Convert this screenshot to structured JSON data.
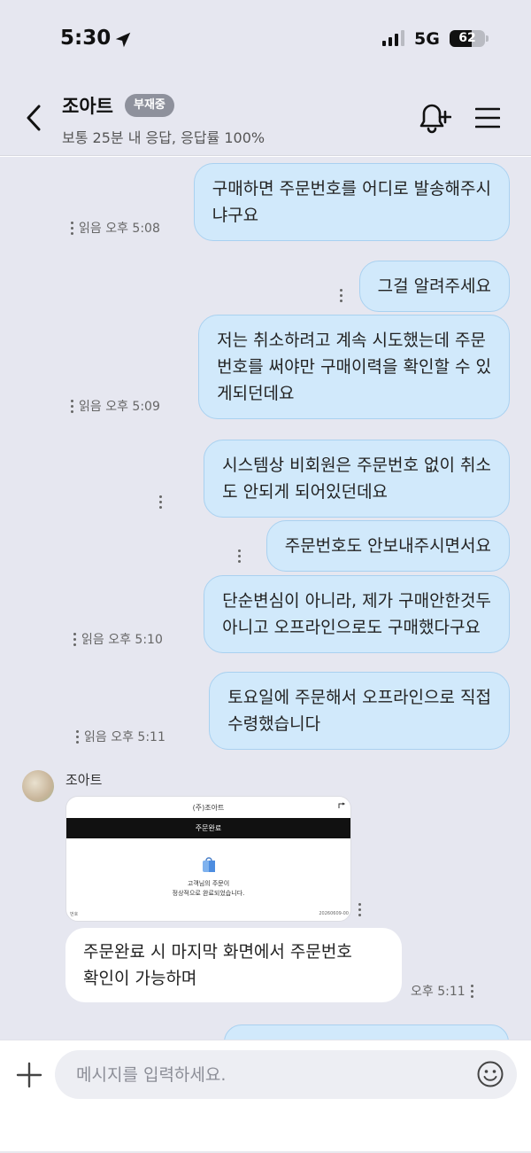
{
  "status_bar": {
    "time": "5:30",
    "network": "5G",
    "battery_percent": "62",
    "battery_level": 0.62,
    "location_icon": "location-arrow-icon",
    "signal_icon": "signal-bars-icon"
  },
  "header": {
    "back_icon": "chevron-left-icon",
    "name": "조아트",
    "badge": "부재중",
    "subtitle": "보통 25분 내 응답, 응답률 100%",
    "notify_icon": "bell-plus-icon",
    "menu_icon": "hamburger-menu-icon"
  },
  "messages": [
    {
      "direction": "out",
      "text": "구매하면 주문번호를 어디로 발송해주시\n냐구요",
      "meta": "읽음 오후 5:08"
    },
    {
      "direction": "out",
      "text": "그걸 알려주세요",
      "meta": ""
    },
    {
      "direction": "out",
      "text": "저는 취소하려고 계속 시도했는데 주문\n번호를 써야만 구매이력을 확인할 수 있\n게되던데요",
      "meta": "읽음 오후 5:09"
    },
    {
      "direction": "out",
      "text": "시스템상 비회원은 주문번호 없이 취소\n도 안되게 되어있던데요",
      "meta": ""
    },
    {
      "direction": "out",
      "text": "주문번호도 안보내주시면서요",
      "meta": ""
    },
    {
      "direction": "out",
      "text": "단순변심이 아니라, 제가 구매안한것두\n아니고 오프라인으로도 구매했다구요",
      "meta": "읽음 오후 5:10"
    },
    {
      "direction": "out",
      "text": "토요일에 주문해서 오프라인으로 직접\n수령했습니다",
      "meta": "읽음 오후 5:11"
    },
    {
      "direction": "in",
      "text": "주문완료 시 마지막 화면에서 주문번호\n확인이 가능하며",
      "meta": "오후 5:11"
    }
  ],
  "incoming": {
    "sender": "조아트",
    "avatar_icon": "store-avatar",
    "image_card": {
      "title": "(주)조아트",
      "bar": "주문완료",
      "line1": "고객님의 주문이",
      "line2": "정상적으로 완료되었습니다.",
      "left_text": "번호",
      "right_text": "20260609-00"
    }
  },
  "input": {
    "placeholder": "메시지를 입력하세요.",
    "value": "",
    "plus_icon": "plus-icon",
    "emoji_icon": "smiley-icon"
  },
  "colors": {
    "chat_background": "#e6e7f0",
    "outgoing_bubble": "#d1e9fb",
    "outgoing_border": "#a9d1f0",
    "incoming_bubble": "#ffffff",
    "badge": "#8e919c"
  }
}
